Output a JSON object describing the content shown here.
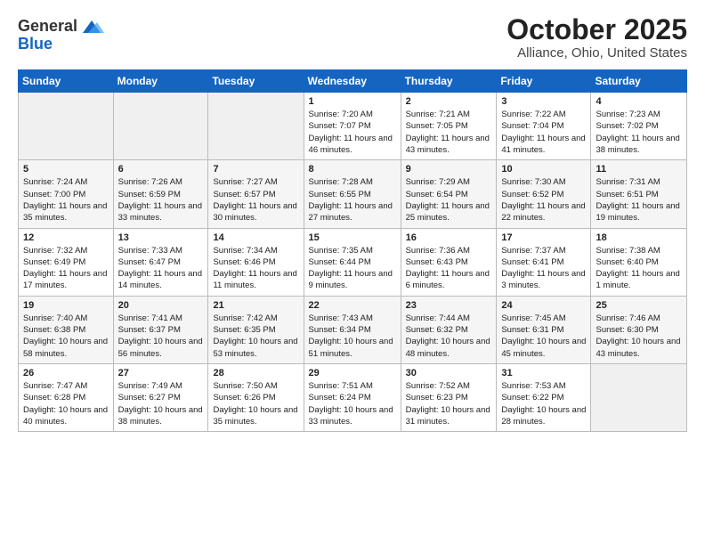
{
  "header": {
    "logo_general": "General",
    "logo_blue": "Blue",
    "title": "October 2025",
    "subtitle": "Alliance, Ohio, United States"
  },
  "calendar": {
    "days_of_week": [
      "Sunday",
      "Monday",
      "Tuesday",
      "Wednesday",
      "Thursday",
      "Friday",
      "Saturday"
    ],
    "weeks": [
      [
        {
          "day": "",
          "info": ""
        },
        {
          "day": "",
          "info": ""
        },
        {
          "day": "",
          "info": ""
        },
        {
          "day": "1",
          "info": "Sunrise: 7:20 AM\nSunset: 7:07 PM\nDaylight: 11 hours and 46 minutes."
        },
        {
          "day": "2",
          "info": "Sunrise: 7:21 AM\nSunset: 7:05 PM\nDaylight: 11 hours and 43 minutes."
        },
        {
          "day": "3",
          "info": "Sunrise: 7:22 AM\nSunset: 7:04 PM\nDaylight: 11 hours and 41 minutes."
        },
        {
          "day": "4",
          "info": "Sunrise: 7:23 AM\nSunset: 7:02 PM\nDaylight: 11 hours and 38 minutes."
        }
      ],
      [
        {
          "day": "5",
          "info": "Sunrise: 7:24 AM\nSunset: 7:00 PM\nDaylight: 11 hours and 35 minutes."
        },
        {
          "day": "6",
          "info": "Sunrise: 7:26 AM\nSunset: 6:59 PM\nDaylight: 11 hours and 33 minutes."
        },
        {
          "day": "7",
          "info": "Sunrise: 7:27 AM\nSunset: 6:57 PM\nDaylight: 11 hours and 30 minutes."
        },
        {
          "day": "8",
          "info": "Sunrise: 7:28 AM\nSunset: 6:55 PM\nDaylight: 11 hours and 27 minutes."
        },
        {
          "day": "9",
          "info": "Sunrise: 7:29 AM\nSunset: 6:54 PM\nDaylight: 11 hours and 25 minutes."
        },
        {
          "day": "10",
          "info": "Sunrise: 7:30 AM\nSunset: 6:52 PM\nDaylight: 11 hours and 22 minutes."
        },
        {
          "day": "11",
          "info": "Sunrise: 7:31 AM\nSunset: 6:51 PM\nDaylight: 11 hours and 19 minutes."
        }
      ],
      [
        {
          "day": "12",
          "info": "Sunrise: 7:32 AM\nSunset: 6:49 PM\nDaylight: 11 hours and 17 minutes."
        },
        {
          "day": "13",
          "info": "Sunrise: 7:33 AM\nSunset: 6:47 PM\nDaylight: 11 hours and 14 minutes."
        },
        {
          "day": "14",
          "info": "Sunrise: 7:34 AM\nSunset: 6:46 PM\nDaylight: 11 hours and 11 minutes."
        },
        {
          "day": "15",
          "info": "Sunrise: 7:35 AM\nSunset: 6:44 PM\nDaylight: 11 hours and 9 minutes."
        },
        {
          "day": "16",
          "info": "Sunrise: 7:36 AM\nSunset: 6:43 PM\nDaylight: 11 hours and 6 minutes."
        },
        {
          "day": "17",
          "info": "Sunrise: 7:37 AM\nSunset: 6:41 PM\nDaylight: 11 hours and 3 minutes."
        },
        {
          "day": "18",
          "info": "Sunrise: 7:38 AM\nSunset: 6:40 PM\nDaylight: 11 hours and 1 minute."
        }
      ],
      [
        {
          "day": "19",
          "info": "Sunrise: 7:40 AM\nSunset: 6:38 PM\nDaylight: 10 hours and 58 minutes."
        },
        {
          "day": "20",
          "info": "Sunrise: 7:41 AM\nSunset: 6:37 PM\nDaylight: 10 hours and 56 minutes."
        },
        {
          "day": "21",
          "info": "Sunrise: 7:42 AM\nSunset: 6:35 PM\nDaylight: 10 hours and 53 minutes."
        },
        {
          "day": "22",
          "info": "Sunrise: 7:43 AM\nSunset: 6:34 PM\nDaylight: 10 hours and 51 minutes."
        },
        {
          "day": "23",
          "info": "Sunrise: 7:44 AM\nSunset: 6:32 PM\nDaylight: 10 hours and 48 minutes."
        },
        {
          "day": "24",
          "info": "Sunrise: 7:45 AM\nSunset: 6:31 PM\nDaylight: 10 hours and 45 minutes."
        },
        {
          "day": "25",
          "info": "Sunrise: 7:46 AM\nSunset: 6:30 PM\nDaylight: 10 hours and 43 minutes."
        }
      ],
      [
        {
          "day": "26",
          "info": "Sunrise: 7:47 AM\nSunset: 6:28 PM\nDaylight: 10 hours and 40 minutes."
        },
        {
          "day": "27",
          "info": "Sunrise: 7:49 AM\nSunset: 6:27 PM\nDaylight: 10 hours and 38 minutes."
        },
        {
          "day": "28",
          "info": "Sunrise: 7:50 AM\nSunset: 6:26 PM\nDaylight: 10 hours and 35 minutes."
        },
        {
          "day": "29",
          "info": "Sunrise: 7:51 AM\nSunset: 6:24 PM\nDaylight: 10 hours and 33 minutes."
        },
        {
          "day": "30",
          "info": "Sunrise: 7:52 AM\nSunset: 6:23 PM\nDaylight: 10 hours and 31 minutes."
        },
        {
          "day": "31",
          "info": "Sunrise: 7:53 AM\nSunset: 6:22 PM\nDaylight: 10 hours and 28 minutes."
        },
        {
          "day": "",
          "info": ""
        }
      ]
    ]
  }
}
